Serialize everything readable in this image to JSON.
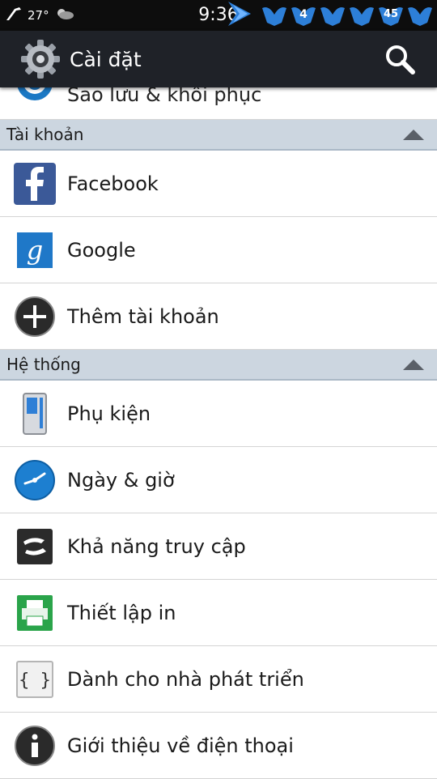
{
  "status": {
    "temperature": "27°",
    "time": "9:36",
    "badges": [
      "4",
      "45"
    ]
  },
  "action_bar": {
    "title": "Cài đặt",
    "icon": "settings-gear-icon",
    "search_icon": "search-icon"
  },
  "partial_item": {
    "label": "Sao lưu & khôi phục",
    "icon": "backup-icon"
  },
  "sections": {
    "accounts": {
      "header": "Tài khoản",
      "items": [
        {
          "label": "Facebook",
          "icon": "facebook-icon"
        },
        {
          "label": "Google",
          "icon": "google-icon"
        },
        {
          "label": "Thêm tài khoản",
          "icon": "add-icon"
        }
      ]
    },
    "system": {
      "header": "Hệ thống",
      "items": [
        {
          "label": "Phụ kiện",
          "icon": "accessory-icon"
        },
        {
          "label": "Ngày & giờ",
          "icon": "clock-icon"
        },
        {
          "label": "Khả năng truy cập",
          "icon": "accessibility-icon"
        },
        {
          "label": "Thiết lập in",
          "icon": "printer-icon"
        },
        {
          "label": "Dành cho nhà phát triển",
          "icon": "developer-icon"
        },
        {
          "label": "Giới thiệu về điện thoại",
          "icon": "info-icon"
        }
      ]
    }
  },
  "colors": {
    "actionbar": "#1f2228",
    "section_header": "#ccd6e0",
    "badge_blue": "#2d7fd8"
  }
}
